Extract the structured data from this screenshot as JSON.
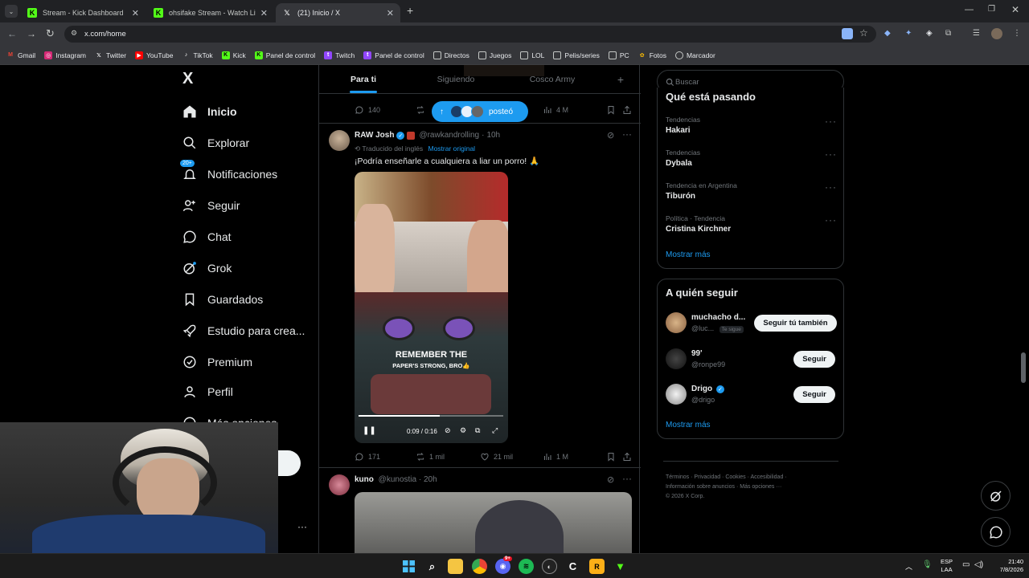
{
  "browser": {
    "tabs": [
      {
        "title": "Stream - Kick Dashboard",
        "favicon": "kick-icon"
      },
      {
        "title": "ohsifake Stream - Watch Live on Kick",
        "favicon": "kick-icon"
      },
      {
        "title": "(21) Inicio / X",
        "favicon": "x-icon",
        "active": true
      }
    ],
    "url": "x.com/home",
    "bookmarks": [
      {
        "label": "Gmail",
        "icon": "gmail-icon"
      },
      {
        "label": "Instagram",
        "icon": "instagram-icon"
      },
      {
        "label": "Twitter",
        "icon": "x-icon"
      },
      {
        "label": "YouTube",
        "icon": "youtube-icon"
      },
      {
        "label": "TikTok",
        "icon": "tiktok-icon"
      },
      {
        "label": "Kick",
        "icon": "kick-icon"
      },
      {
        "label": "Panel de control",
        "icon": "kick-icon"
      },
      {
        "label": "Twitch",
        "icon": "twitch-icon"
      },
      {
        "label": "Panel de control",
        "icon": "twitch-icon"
      },
      {
        "label": "Directos",
        "icon": "folder-icon"
      },
      {
        "label": "Juegos",
        "icon": "folder-icon"
      },
      {
        "label": "LOL",
        "icon": "folder-icon"
      },
      {
        "label": "Pelis/series",
        "icon": "folder-icon"
      },
      {
        "label": "PC",
        "icon": "folder-icon"
      },
      {
        "label": "Fotos",
        "icon": "folder-icon"
      },
      {
        "label": "Marcador",
        "icon": "globe-icon"
      }
    ]
  },
  "sidebar": {
    "logo": "X",
    "badge": "20+",
    "items": [
      {
        "label": "Inicio",
        "icon": "home-icon"
      },
      {
        "label": "Explorar",
        "icon": "search-icon"
      },
      {
        "label": "Notificaciones",
        "icon": "bell-icon"
      },
      {
        "label": "Seguir",
        "icon": "person-plus-icon"
      },
      {
        "label": "Chat",
        "icon": "chat-icon"
      },
      {
        "label": "Grok",
        "icon": "grok-icon"
      },
      {
        "label": "Guardados",
        "icon": "bookmark-icon"
      },
      {
        "label": "Estudio para crea...",
        "icon": "rocket-icon"
      },
      {
        "label": "Premium",
        "icon": "premium-icon"
      },
      {
        "label": "Perfil",
        "icon": "person-icon"
      },
      {
        "label": "Más opciones",
        "icon": "more-icon"
      }
    ],
    "more_dots": "···"
  },
  "feed": {
    "tabs": [
      "Para ti",
      "Siguiendo",
      "Cosco Army"
    ],
    "add_tab": "+",
    "posted_pill": "posteó",
    "prev_post_stats": {
      "replies": "140",
      "views": "4 M"
    },
    "post1": {
      "name": "RAW Josh",
      "handle": "@rawkandrolling",
      "time": "10h",
      "translated": "Traducido del inglés",
      "show_original": "Mostrar original",
      "text": "¡Podría enseñarle a cualquiera a liar un porro! 🙏",
      "video_caption_1": "REMEMBER THE",
      "video_caption_2": "PAPER'S STRONG, BRO👍",
      "video_time": "0:09 / 0:16",
      "video_progress": 0.5625,
      "stats": {
        "replies": "171",
        "reposts": "1 mil",
        "likes": "21 mil",
        "views": "1 M"
      }
    },
    "post2": {
      "name": "kuno",
      "handle": "@kunostia",
      "time": "20h"
    }
  },
  "right": {
    "search_placeholder": "Buscar",
    "trends_title": "Qué está pasando",
    "trends": [
      {
        "meta": "Tendencias",
        "name": "Hakari"
      },
      {
        "meta": "Tendencias",
        "name": "Dybala"
      },
      {
        "meta": "Tendencia en Argentina",
        "name": "Tiburón"
      },
      {
        "meta": "Política · Tendencia",
        "name": "Cristina Kirchner"
      }
    ],
    "show_more": "Mostrar más",
    "follow_title": "A quién seguir",
    "follow": [
      {
        "name": "muchacho d...",
        "handle": "@luc...",
        "tag": "Te sigue",
        "button": "Seguir tú también"
      },
      {
        "name": "99'",
        "handle": "@ronpe99",
        "button": "Seguir"
      },
      {
        "name": "Drigo",
        "handle": "@drigo",
        "button": "Seguir"
      }
    ],
    "footer": {
      "links": [
        "Términos",
        "Privacidad",
        "Cookies",
        "Accesibilidad",
        "Información sobre anuncios",
        "Más opciones ···"
      ],
      "copyright": "© 2026 X Corp."
    }
  },
  "taskbar": {
    "lang1": "ESP",
    "lang2": "LAA",
    "time": "21:40",
    "date": "7/8/2026",
    "discord_badge": "9+"
  },
  "colors": {
    "accent": "#1d9bf0",
    "kick": "#53fc18",
    "bg": "#000000",
    "border": "#2f3336"
  }
}
